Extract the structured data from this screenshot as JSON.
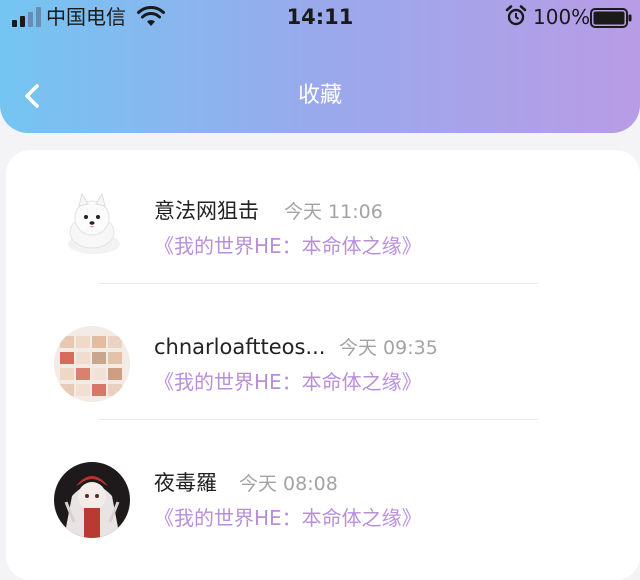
{
  "status_bar": {
    "carrier": "中国电信",
    "time": "14:11",
    "battery": "100%"
  },
  "header": {
    "title": "收藏",
    "back_icon": "chevron-left-icon"
  },
  "favorites": [
    {
      "username": "意法网狙击",
      "time": "今天 11:06",
      "book": "《我的世界HE：本命体之缘》"
    },
    {
      "username": "chnarloaftteos...",
      "time": "今天 09:35",
      "book": "《我的世界HE：本命体之缘》"
    },
    {
      "username": "夜毒羅",
      "time": "今天 08:08",
      "book": "《我的世界HE：本命体之缘》"
    }
  ]
}
